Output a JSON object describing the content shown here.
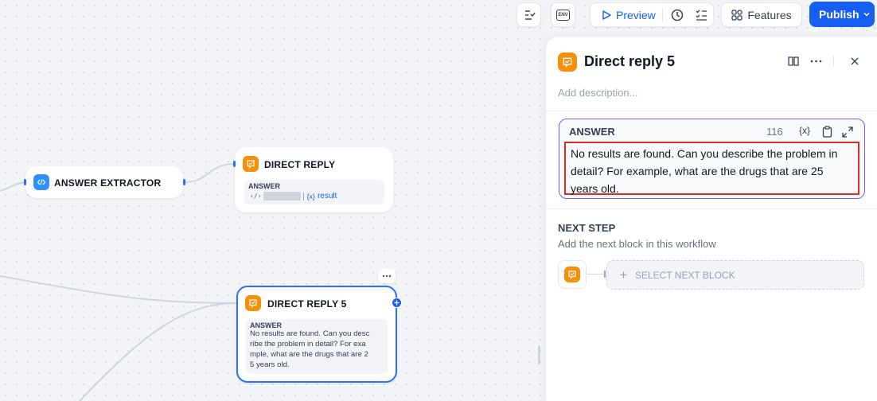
{
  "toolbar": {
    "preview_label": "Preview",
    "features_label": "Features",
    "publish_label": "Publish",
    "env_text": "ENV"
  },
  "nodes": {
    "answer_extractor": {
      "title": "ANSWER EXTRACTOR"
    },
    "direct_reply": {
      "title": "DIRECT REPLY",
      "answer_label": "ANSWER",
      "var_label": "result"
    },
    "direct_reply_5": {
      "title": "DIRECT REPLY 5",
      "answer_label": "ANSWER",
      "answer_lines": [
        "No results are found. Can you desc",
        "ribe the problem in detail? For exa",
        "mple, what are the drugs that are 2",
        "5 years old."
      ]
    }
  },
  "panel": {
    "title": "Direct reply 5",
    "description_placeholder": "Add description...",
    "answer_label": "ANSWER",
    "char_count": "116",
    "answer_text": "No results are found. Can you describe the problem in detail? For example, what are the drugs that are 25 years old.",
    "next_step_title": "NEXT STEP",
    "next_step_desc": "Add the next block in this workflow",
    "select_next_block": "SELECT NEXT BLOCK"
  },
  "colors": {
    "accent": "#155eef",
    "orange_badge": "#f79009",
    "blue_badge": "#2e90fa",
    "focus_border": "#7a5af8",
    "highlight_red": "#d92d20"
  }
}
